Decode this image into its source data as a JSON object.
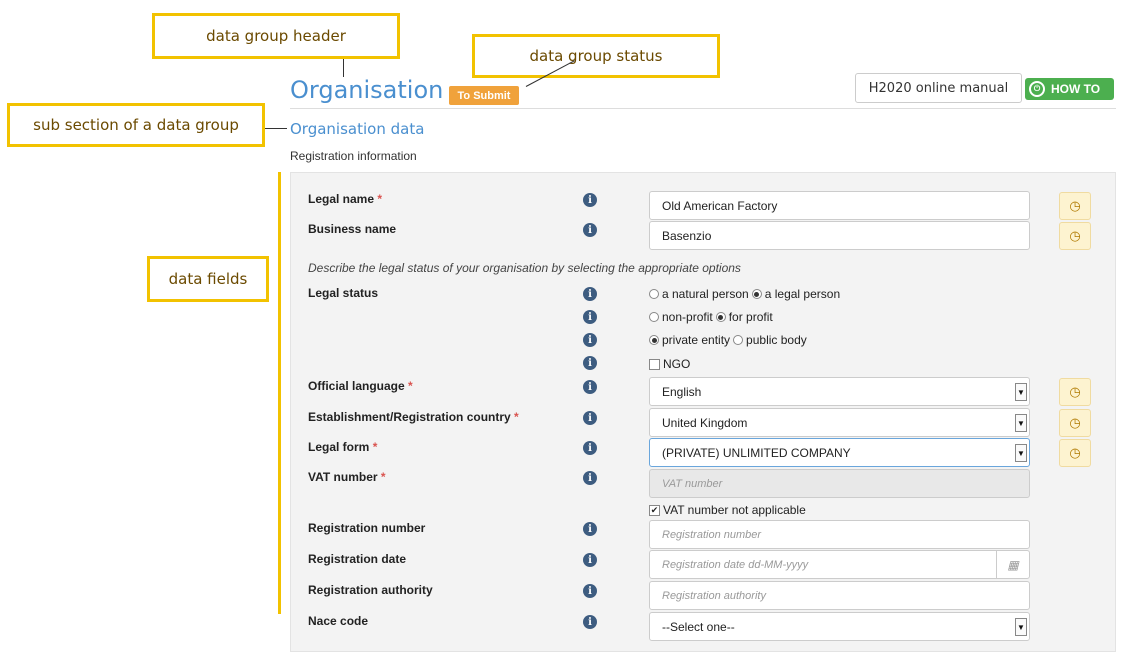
{
  "callouts": {
    "group_header": "data group header",
    "group_status": "data group status",
    "sub_section": "sub section of a data group",
    "data_fields": "data fields"
  },
  "header": {
    "title": "Organisation",
    "status": "To Submit",
    "manual_label": "H2020 online manual",
    "howto_label": "HOW TO"
  },
  "section": {
    "title": "Organisation data",
    "subsection": "Registration information"
  },
  "form": {
    "legal_name": {
      "label": "Legal name",
      "value": "Old American Factory"
    },
    "business_name": {
      "label": "Business name",
      "value": "Basenzio"
    },
    "legal_status_note": "Describe the legal status of your organisation by selecting the appropriate options",
    "legal_status": {
      "label": "Legal status",
      "natural_person": "a natural person",
      "legal_person": "a legal person",
      "non_profit": "non-profit",
      "for_profit": "for profit",
      "private_entity": "private entity",
      "public_body": "public body",
      "ngo": "NGO"
    },
    "official_language": {
      "label": "Official language",
      "value": "English"
    },
    "country": {
      "label": "Establishment/Registration country",
      "value": "United Kingdom"
    },
    "legal_form": {
      "label": "Legal form",
      "value": "(PRIVATE) UNLIMITED COMPANY"
    },
    "vat": {
      "label": "VAT number",
      "placeholder": "VAT number",
      "not_applicable": "VAT number not applicable"
    },
    "registration_number": {
      "label": "Registration number",
      "placeholder": "Registration number"
    },
    "registration_date": {
      "label": "Registration date",
      "placeholder": "Registration date dd-MM-yyyy"
    },
    "registration_authority": {
      "label": "Registration authority",
      "placeholder": "Registration authority"
    },
    "nace": {
      "label": "Nace code",
      "value": "--Select one--"
    },
    "required_mark": "*",
    "info_glyph": "i",
    "history_glyph": "◷"
  },
  "icons": [
    "info-icon",
    "history-icon",
    "calendar-icon",
    "dropdown-caret-icon",
    "howto-icon"
  ],
  "colors": {
    "accent": "#4a8fcf",
    "status": "#f0a23b",
    "howto": "#4caf4f",
    "callout": "#f2c200"
  }
}
